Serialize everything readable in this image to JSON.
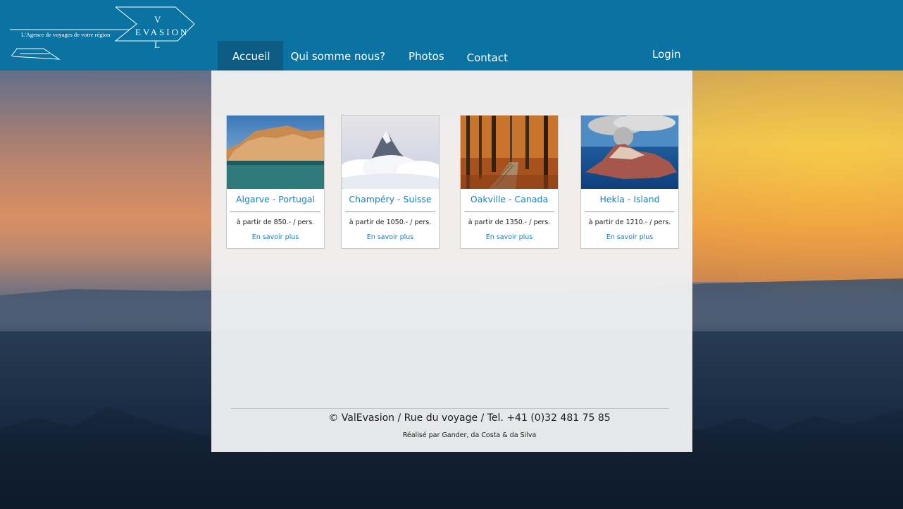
{
  "header": {
    "tagline": "L'Agence de voyages de votre région",
    "logo": {
      "top_letter": "V",
      "word": "EVASION",
      "bottom_letter": "L"
    },
    "nav": [
      "Accueil",
      "Qui somme nous?",
      "Photos",
      "Contact"
    ],
    "active_nav": "Accueil",
    "login": "Login"
  },
  "cards": [
    {
      "title": "Algarve - Portugal",
      "price": "à partir de 850.- / pers.",
      "link": "En savoir plus"
    },
    {
      "title": "Champéry - Suisse",
      "price": "à partir de 1050.- / pers.",
      "link": "En savoir plus"
    },
    {
      "title": "Oakville - Canada",
      "price": "à partir de 1350.- / pers.",
      "link": "En savoir plus"
    },
    {
      "title": "Hekla - Island",
      "price": "à partir de 1210.- / pers.",
      "link": "En savoir plus"
    }
  ],
  "footer": {
    "main": "© ValEvasion / Rue du voyage / Tel. +41 (0)32 481 75 85",
    "credits": "Réalisé par Gander, da Costa & da Silva"
  },
  "colors": {
    "header": "#0a73a1",
    "active_nav": "#0b5b82",
    "link": "#1d7fb8"
  }
}
